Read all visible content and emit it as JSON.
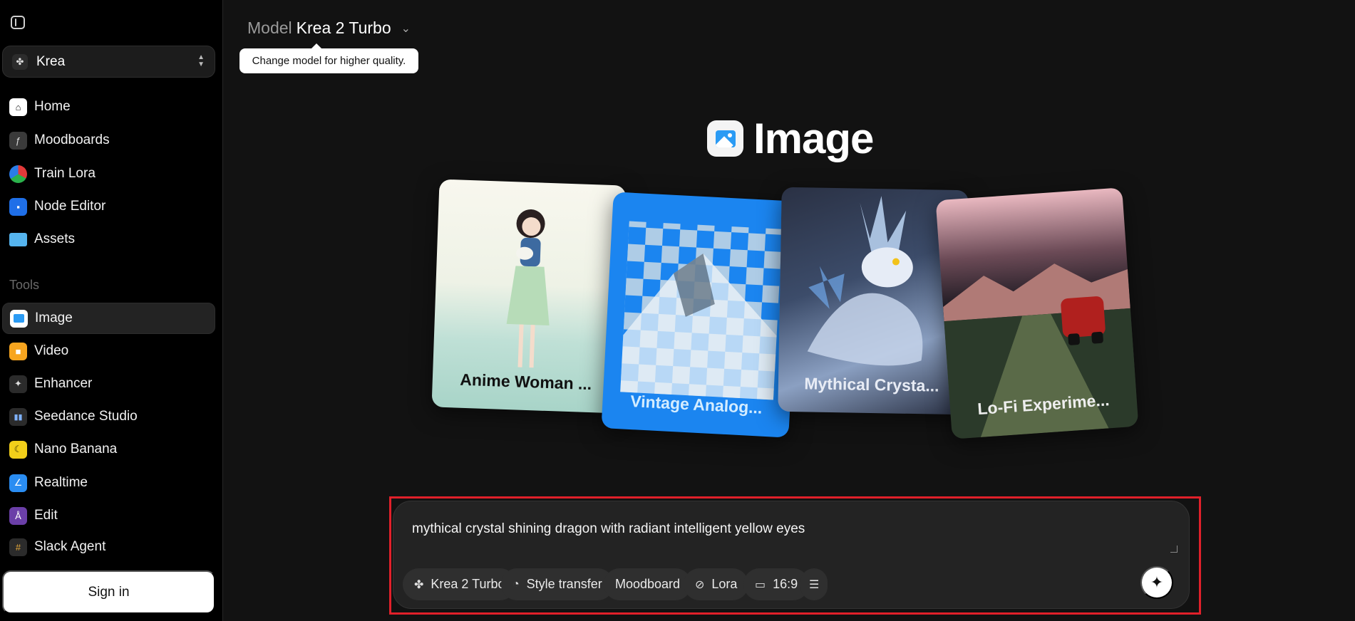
{
  "sidebar": {
    "workspace": {
      "name": "Krea"
    },
    "items": [
      {
        "label": "Home",
        "icon": "home-icon",
        "color": "#ffffff"
      },
      {
        "label": "Moodboards",
        "icon": "moodboard-icon",
        "color": "#444444"
      },
      {
        "label": "Train Lora",
        "icon": "train-lora-icon",
        "color": "#e23a3a"
      },
      {
        "label": "Node Editor",
        "icon": "node-editor-icon",
        "color": "#1f6fe8"
      },
      {
        "label": "Assets",
        "icon": "folder-icon",
        "color": "#55b4ee"
      }
    ],
    "tools_label": "Tools",
    "tools": [
      {
        "label": "Image",
        "icon": "image-icon",
        "color": "#ffffff",
        "active": true
      },
      {
        "label": "Video",
        "icon": "video-icon",
        "color": "#f7a51f"
      },
      {
        "label": "Enhancer",
        "icon": "enhancer-icon",
        "color": "#2b2b2b"
      },
      {
        "label": "Seedance Studio",
        "icon": "seedance-studio-icon",
        "color": "#2b2b2b"
      },
      {
        "label": "Nano Banana",
        "icon": "banana-icon",
        "color": "#f2cf1a"
      },
      {
        "label": "Realtime",
        "icon": "realtime-icon",
        "color": "#2a8df2"
      },
      {
        "label": "Edit",
        "icon": "edit-icon",
        "color": "#6b3fa8"
      },
      {
        "label": "Slack Agent",
        "icon": "slack-icon",
        "color": "#2b2b2b"
      }
    ],
    "sign_in_label": "Sign in"
  },
  "header": {
    "model_prefix": "Model",
    "model_name": "Krea 2 Turbo",
    "tooltip": "Change model for higher quality."
  },
  "hero": {
    "title": "Image"
  },
  "cards": [
    {
      "label": "Anime Woman ..."
    },
    {
      "label": "Vintage Analog..."
    },
    {
      "label": "Mythical Crysta..."
    },
    {
      "label": "Lo-Fi Experime..."
    }
  ],
  "prompt": {
    "text": "mythical crystal shining dragon with radiant intelligent yellow eyes",
    "chips": {
      "model": "Krea 2 Turbo",
      "style": "Style transfer",
      "moodboard": "Moodboard",
      "lora": "Lora",
      "aspect": "16:9"
    }
  }
}
